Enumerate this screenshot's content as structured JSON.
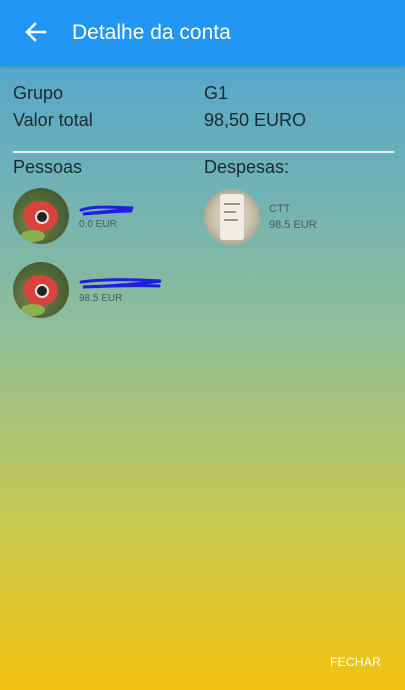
{
  "appbar": {
    "title": "Detalhe da conta",
    "back_icon": "arrow-left-icon"
  },
  "info": {
    "group_label": "Grupo",
    "group_value": "G1",
    "total_label": "Valor total",
    "total_value": "98,50 EURO"
  },
  "sections": {
    "people_title": "Pessoas",
    "expenses_title": "Despesas:"
  },
  "people": [
    {
      "name": "",
      "amount": "0.0 EUR"
    },
    {
      "name": "",
      "amount": "98.5 EUR"
    }
  ],
  "expenses": [
    {
      "name": "CTT",
      "amount": "98.5 EUR"
    }
  ],
  "footer": {
    "close_label": "FECHAR"
  },
  "colors": {
    "appbar": "#2196f3",
    "scribble": "#1f1fdc"
  }
}
